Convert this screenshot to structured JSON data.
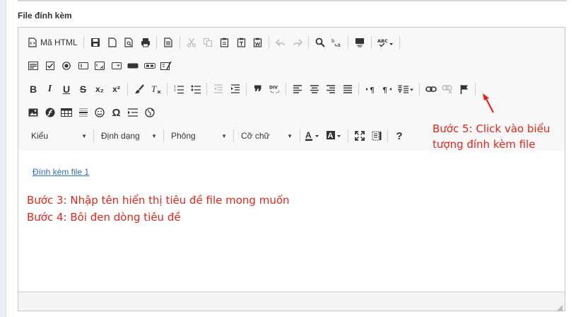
{
  "field_label": "File đính kèm",
  "toolbar": {
    "source_label": "Mã HTML",
    "combos": {
      "style": "Kiểu",
      "format": "Định dạng",
      "font": "Phông",
      "size": "Cỡ chữ"
    },
    "quote_glyph": "❞",
    "div_label": "DIV",
    "omega_glyph": "Ω",
    "superscript_label": "x²",
    "subscript_label": "x₂"
  },
  "content": {
    "link_text": "Đính kèm file 1"
  },
  "annotations": {
    "step5_line1": "Bước 5: Click vào biểu",
    "step5_line2": "tượng đính kèm file",
    "step3": "Bước 3: Nhập tên hiển thị tiêu đề file mong muốn",
    "step4": "Bước 4: Bôi đen dòng tiêu đề",
    "annotation_color": "#e0261c"
  }
}
